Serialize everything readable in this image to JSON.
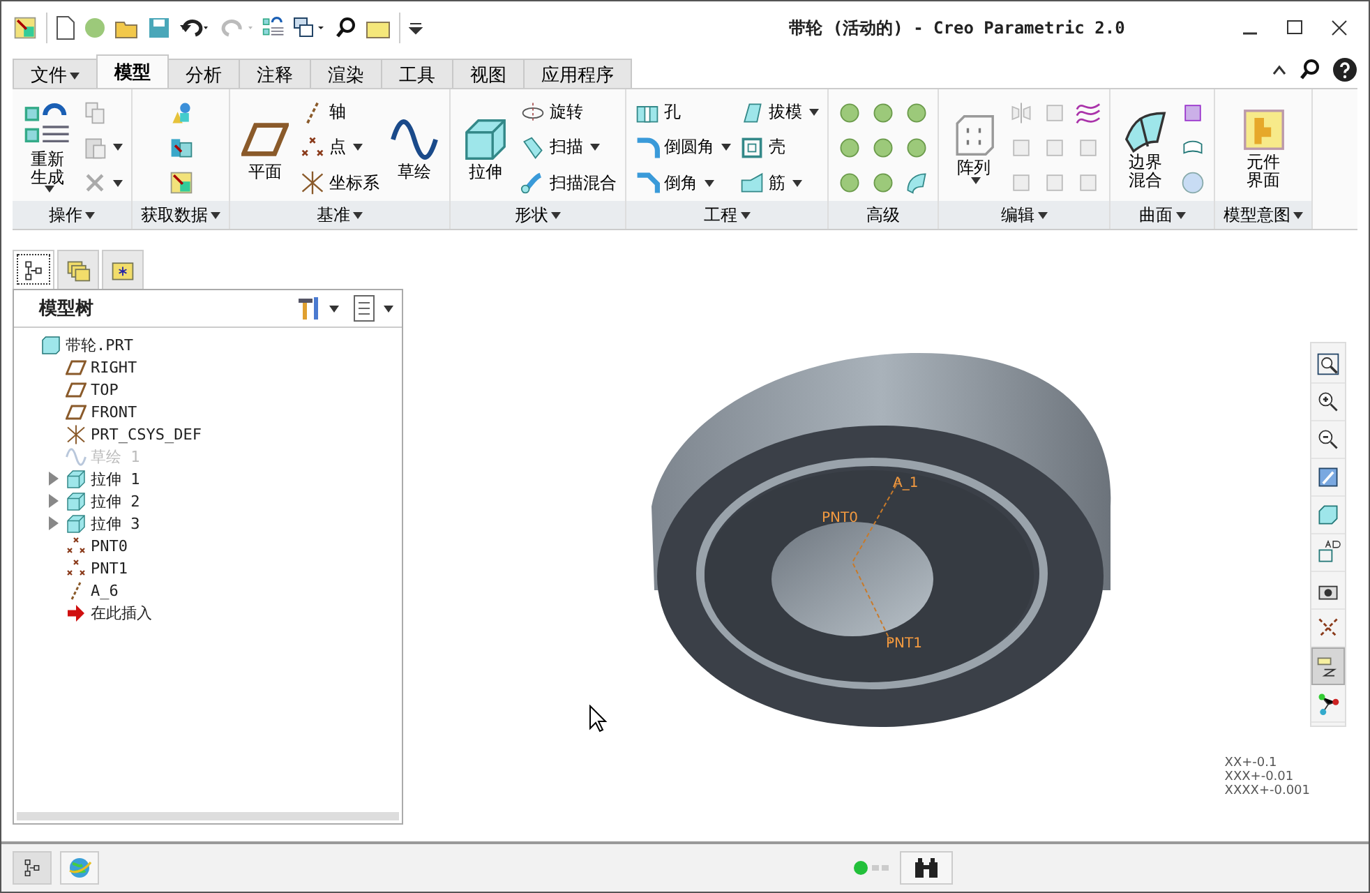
{
  "window": {
    "title": "带轮 (活动的) - Creo Parametric 2.0"
  },
  "ribbon_tabs": [
    {
      "label": "文件",
      "kind": "menu",
      "selected": false
    },
    {
      "label": "模型",
      "kind": "tab",
      "selected": true
    },
    {
      "label": "分析",
      "kind": "tab",
      "selected": false
    },
    {
      "label": "注释",
      "kind": "tab",
      "selected": false
    },
    {
      "label": "渲染",
      "kind": "tab",
      "selected": false
    },
    {
      "label": "工具",
      "kind": "tab",
      "selected": false
    },
    {
      "label": "视图",
      "kind": "tab",
      "selected": false
    },
    {
      "label": "应用程序",
      "kind": "tab",
      "selected": false
    }
  ],
  "ribbon_groups": [
    {
      "label": "操作",
      "dropdown": true,
      "columns": [
        [
          {
            "kind": "large",
            "label": "重新生成",
            "dropdown": true
          }
        ],
        [
          {
            "kind": "icon",
            "dropdown": false
          },
          {
            "kind": "icon",
            "dropdown": true
          },
          {
            "kind": "icon",
            "dropdown": true
          }
        ]
      ]
    },
    {
      "label": "获取数据",
      "dropdown": true,
      "columns": [
        [
          {
            "kind": "icon",
            "dropdown": false
          },
          {
            "kind": "icon",
            "dropdown": false
          },
          {
            "kind": "icon",
            "dropdown": false
          }
        ]
      ]
    },
    {
      "label": "基准",
      "dropdown": true,
      "columns": [
        [
          {
            "kind": "large",
            "label": "平面",
            "dropdown": false
          }
        ],
        [
          {
            "kind": "small",
            "label": "轴",
            "dropdown": false
          },
          {
            "kind": "small",
            "label": "点",
            "dropdown": true
          },
          {
            "kind": "small",
            "label": "坐标系",
            "dropdown": false
          }
        ],
        [
          {
            "kind": "large",
            "label": "草绘",
            "dropdown": false
          }
        ]
      ]
    },
    {
      "label": "形状",
      "dropdown": true,
      "columns": [
        [
          {
            "kind": "large",
            "label": "拉伸",
            "dropdown": false
          }
        ],
        [
          {
            "kind": "small",
            "label": "旋转",
            "dropdown": false
          },
          {
            "kind": "small",
            "label": "扫描",
            "dropdown": true
          },
          {
            "kind": "small",
            "label": "扫描混合",
            "dropdown": false
          }
        ]
      ]
    },
    {
      "label": "工程",
      "dropdown": true,
      "columns": [
        [
          {
            "kind": "small",
            "label": "孔",
            "dropdown": false
          },
          {
            "kind": "small",
            "label": "倒圆角",
            "dropdown": true
          },
          {
            "kind": "small",
            "label": "倒角",
            "dropdown": true
          }
        ],
        [
          {
            "kind": "small",
            "label": "拔模",
            "dropdown": true
          },
          {
            "kind": "small",
            "label": "壳",
            "dropdown": false
          },
          {
            "kind": "small",
            "label": "筋",
            "dropdown": true
          }
        ]
      ]
    },
    {
      "label": "高级",
      "dropdown": false,
      "columns": [
        [
          {
            "kind": "icon",
            "dropdown": false
          },
          {
            "kind": "icon",
            "dropdown": false
          },
          {
            "kind": "icon",
            "dropdown": false
          }
        ],
        [
          {
            "kind": "icon",
            "dropdown": false
          },
          {
            "kind": "icon",
            "dropdown": false
          },
          {
            "kind": "icon",
            "dropdown": false
          }
        ],
        [
          {
            "kind": "icon",
            "dropdown": false
          },
          {
            "kind": "icon",
            "dropdown": false
          },
          {
            "kind": "icon",
            "dropdown": false
          }
        ]
      ]
    },
    {
      "label": "编辑",
      "dropdown": true,
      "columns": [
        [
          {
            "kind": "large",
            "label": "阵列",
            "dropdown": true
          }
        ],
        [
          {
            "kind": "icon",
            "dropdown": false
          },
          {
            "kind": "icon",
            "dropdown": false
          },
          {
            "kind": "icon",
            "dropdown": false
          }
        ],
        [
          {
            "kind": "icon",
            "dropdown": false
          },
          {
            "kind": "icon",
            "dropdown": false
          },
          {
            "kind": "icon",
            "dropdown": false
          }
        ],
        [
          {
            "kind": "icon",
            "dropdown": false
          },
          {
            "kind": "icon",
            "dropdown": false
          },
          {
            "kind": "icon",
            "dropdown": false
          }
        ]
      ]
    },
    {
      "label": "曲面",
      "dropdown": true,
      "columns": [
        [
          {
            "kind": "large",
            "label": "边界混合",
            "dropdown": false
          }
        ],
        [
          {
            "kind": "icon",
            "dropdown": false
          },
          {
            "kind": "icon",
            "dropdown": false
          },
          {
            "kind": "icon",
            "dropdown": false
          }
        ]
      ]
    },
    {
      "label": "模型意图",
      "dropdown": true,
      "columns": [
        [
          {
            "kind": "large",
            "label": "元件界面",
            "dropdown": false
          }
        ]
      ]
    }
  ],
  "navigator_tabs": [
    {
      "selected": true
    },
    {
      "selected": false
    },
    {
      "selected": false
    }
  ],
  "model_tree": {
    "title": "模型树",
    "items": [
      {
        "label": "带轮.PRT",
        "kind": "part",
        "disabled": false,
        "children": [
          {
            "label": "RIGHT",
            "kind": "plane",
            "disabled": false
          },
          {
            "label": "TOP",
            "kind": "plane",
            "disabled": false
          },
          {
            "label": "FRONT",
            "kind": "plane",
            "disabled": false
          },
          {
            "label": "PRT_CSYS_DEF",
            "kind": "csys",
            "disabled": false
          },
          {
            "label": "草绘 1",
            "kind": "sketch",
            "disabled": true
          },
          {
            "label": "拉伸 1",
            "kind": "extrude",
            "disabled": false,
            "expanded": false
          },
          {
            "label": "拉伸 2",
            "kind": "extrude",
            "disabled": false,
            "expanded": false
          },
          {
            "label": "拉伸 3",
            "kind": "extrude",
            "disabled": false,
            "expanded": false
          },
          {
            "label": "PNT0",
            "kind": "point",
            "disabled": false
          },
          {
            "label": "PNT1",
            "kind": "point",
            "disabled": false
          },
          {
            "label": "A_6",
            "kind": "axis",
            "disabled": false
          },
          {
            "label": "在此插入",
            "kind": "insert",
            "disabled": false
          }
        ]
      }
    ]
  },
  "graphics": {
    "datum_labels": [
      "A_1",
      "PNT0",
      "PNT1"
    ],
    "tolerances": [
      "XX+-0.1",
      "XXX+-0.01",
      "XXXX+-0.001"
    ],
    "view_tools": [
      {
        "selected": false
      },
      {
        "selected": false
      },
      {
        "selected": false
      },
      {
        "selected": false
      },
      {
        "selected": false
      },
      {
        "selected": false
      },
      {
        "selected": false
      },
      {
        "selected": false
      },
      {
        "selected": true
      },
      {
        "selected": false
      }
    ]
  }
}
